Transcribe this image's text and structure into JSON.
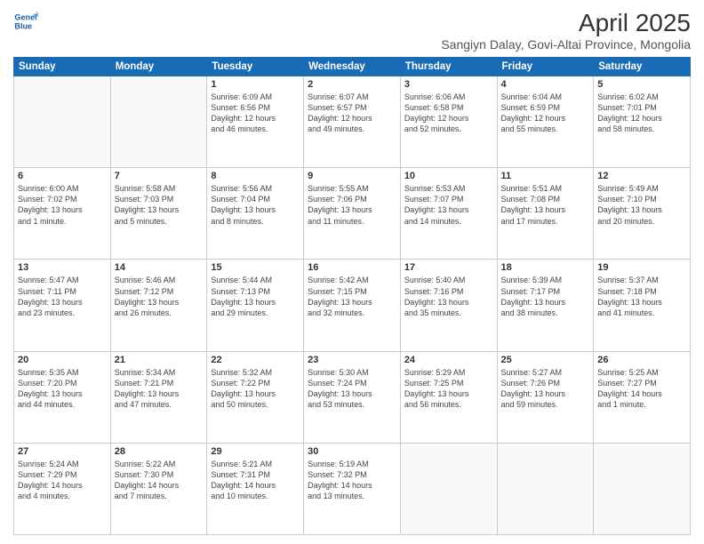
{
  "logo": {
    "line1": "General",
    "line2": "Blue"
  },
  "title": "April 2025",
  "subtitle": "Sangiyn Dalay, Govi-Altai Province, Mongolia",
  "weekdays": [
    "Sunday",
    "Monday",
    "Tuesday",
    "Wednesday",
    "Thursday",
    "Friday",
    "Saturday"
  ],
  "weeks": [
    [
      {
        "day": "",
        "info": ""
      },
      {
        "day": "",
        "info": ""
      },
      {
        "day": "1",
        "info": "Sunrise: 6:09 AM\nSunset: 6:56 PM\nDaylight: 12 hours\nand 46 minutes."
      },
      {
        "day": "2",
        "info": "Sunrise: 6:07 AM\nSunset: 6:57 PM\nDaylight: 12 hours\nand 49 minutes."
      },
      {
        "day": "3",
        "info": "Sunrise: 6:06 AM\nSunset: 6:58 PM\nDaylight: 12 hours\nand 52 minutes."
      },
      {
        "day": "4",
        "info": "Sunrise: 6:04 AM\nSunset: 6:59 PM\nDaylight: 12 hours\nand 55 minutes."
      },
      {
        "day": "5",
        "info": "Sunrise: 6:02 AM\nSunset: 7:01 PM\nDaylight: 12 hours\nand 58 minutes."
      }
    ],
    [
      {
        "day": "6",
        "info": "Sunrise: 6:00 AM\nSunset: 7:02 PM\nDaylight: 13 hours\nand 1 minute."
      },
      {
        "day": "7",
        "info": "Sunrise: 5:58 AM\nSunset: 7:03 PM\nDaylight: 13 hours\nand 5 minutes."
      },
      {
        "day": "8",
        "info": "Sunrise: 5:56 AM\nSunset: 7:04 PM\nDaylight: 13 hours\nand 8 minutes."
      },
      {
        "day": "9",
        "info": "Sunrise: 5:55 AM\nSunset: 7:06 PM\nDaylight: 13 hours\nand 11 minutes."
      },
      {
        "day": "10",
        "info": "Sunrise: 5:53 AM\nSunset: 7:07 PM\nDaylight: 13 hours\nand 14 minutes."
      },
      {
        "day": "11",
        "info": "Sunrise: 5:51 AM\nSunset: 7:08 PM\nDaylight: 13 hours\nand 17 minutes."
      },
      {
        "day": "12",
        "info": "Sunrise: 5:49 AM\nSunset: 7:10 PM\nDaylight: 13 hours\nand 20 minutes."
      }
    ],
    [
      {
        "day": "13",
        "info": "Sunrise: 5:47 AM\nSunset: 7:11 PM\nDaylight: 13 hours\nand 23 minutes."
      },
      {
        "day": "14",
        "info": "Sunrise: 5:46 AM\nSunset: 7:12 PM\nDaylight: 13 hours\nand 26 minutes."
      },
      {
        "day": "15",
        "info": "Sunrise: 5:44 AM\nSunset: 7:13 PM\nDaylight: 13 hours\nand 29 minutes."
      },
      {
        "day": "16",
        "info": "Sunrise: 5:42 AM\nSunset: 7:15 PM\nDaylight: 13 hours\nand 32 minutes."
      },
      {
        "day": "17",
        "info": "Sunrise: 5:40 AM\nSunset: 7:16 PM\nDaylight: 13 hours\nand 35 minutes."
      },
      {
        "day": "18",
        "info": "Sunrise: 5:39 AM\nSunset: 7:17 PM\nDaylight: 13 hours\nand 38 minutes."
      },
      {
        "day": "19",
        "info": "Sunrise: 5:37 AM\nSunset: 7:18 PM\nDaylight: 13 hours\nand 41 minutes."
      }
    ],
    [
      {
        "day": "20",
        "info": "Sunrise: 5:35 AM\nSunset: 7:20 PM\nDaylight: 13 hours\nand 44 minutes."
      },
      {
        "day": "21",
        "info": "Sunrise: 5:34 AM\nSunset: 7:21 PM\nDaylight: 13 hours\nand 47 minutes."
      },
      {
        "day": "22",
        "info": "Sunrise: 5:32 AM\nSunset: 7:22 PM\nDaylight: 13 hours\nand 50 minutes."
      },
      {
        "day": "23",
        "info": "Sunrise: 5:30 AM\nSunset: 7:24 PM\nDaylight: 13 hours\nand 53 minutes."
      },
      {
        "day": "24",
        "info": "Sunrise: 5:29 AM\nSunset: 7:25 PM\nDaylight: 13 hours\nand 56 minutes."
      },
      {
        "day": "25",
        "info": "Sunrise: 5:27 AM\nSunset: 7:26 PM\nDaylight: 13 hours\nand 59 minutes."
      },
      {
        "day": "26",
        "info": "Sunrise: 5:25 AM\nSunset: 7:27 PM\nDaylight: 14 hours\nand 1 minute."
      }
    ],
    [
      {
        "day": "27",
        "info": "Sunrise: 5:24 AM\nSunset: 7:29 PM\nDaylight: 14 hours\nand 4 minutes."
      },
      {
        "day": "28",
        "info": "Sunrise: 5:22 AM\nSunset: 7:30 PM\nDaylight: 14 hours\nand 7 minutes."
      },
      {
        "day": "29",
        "info": "Sunrise: 5:21 AM\nSunset: 7:31 PM\nDaylight: 14 hours\nand 10 minutes."
      },
      {
        "day": "30",
        "info": "Sunrise: 5:19 AM\nSunset: 7:32 PM\nDaylight: 14 hours\nand 13 minutes."
      },
      {
        "day": "",
        "info": ""
      },
      {
        "day": "",
        "info": ""
      },
      {
        "day": "",
        "info": ""
      }
    ]
  ]
}
